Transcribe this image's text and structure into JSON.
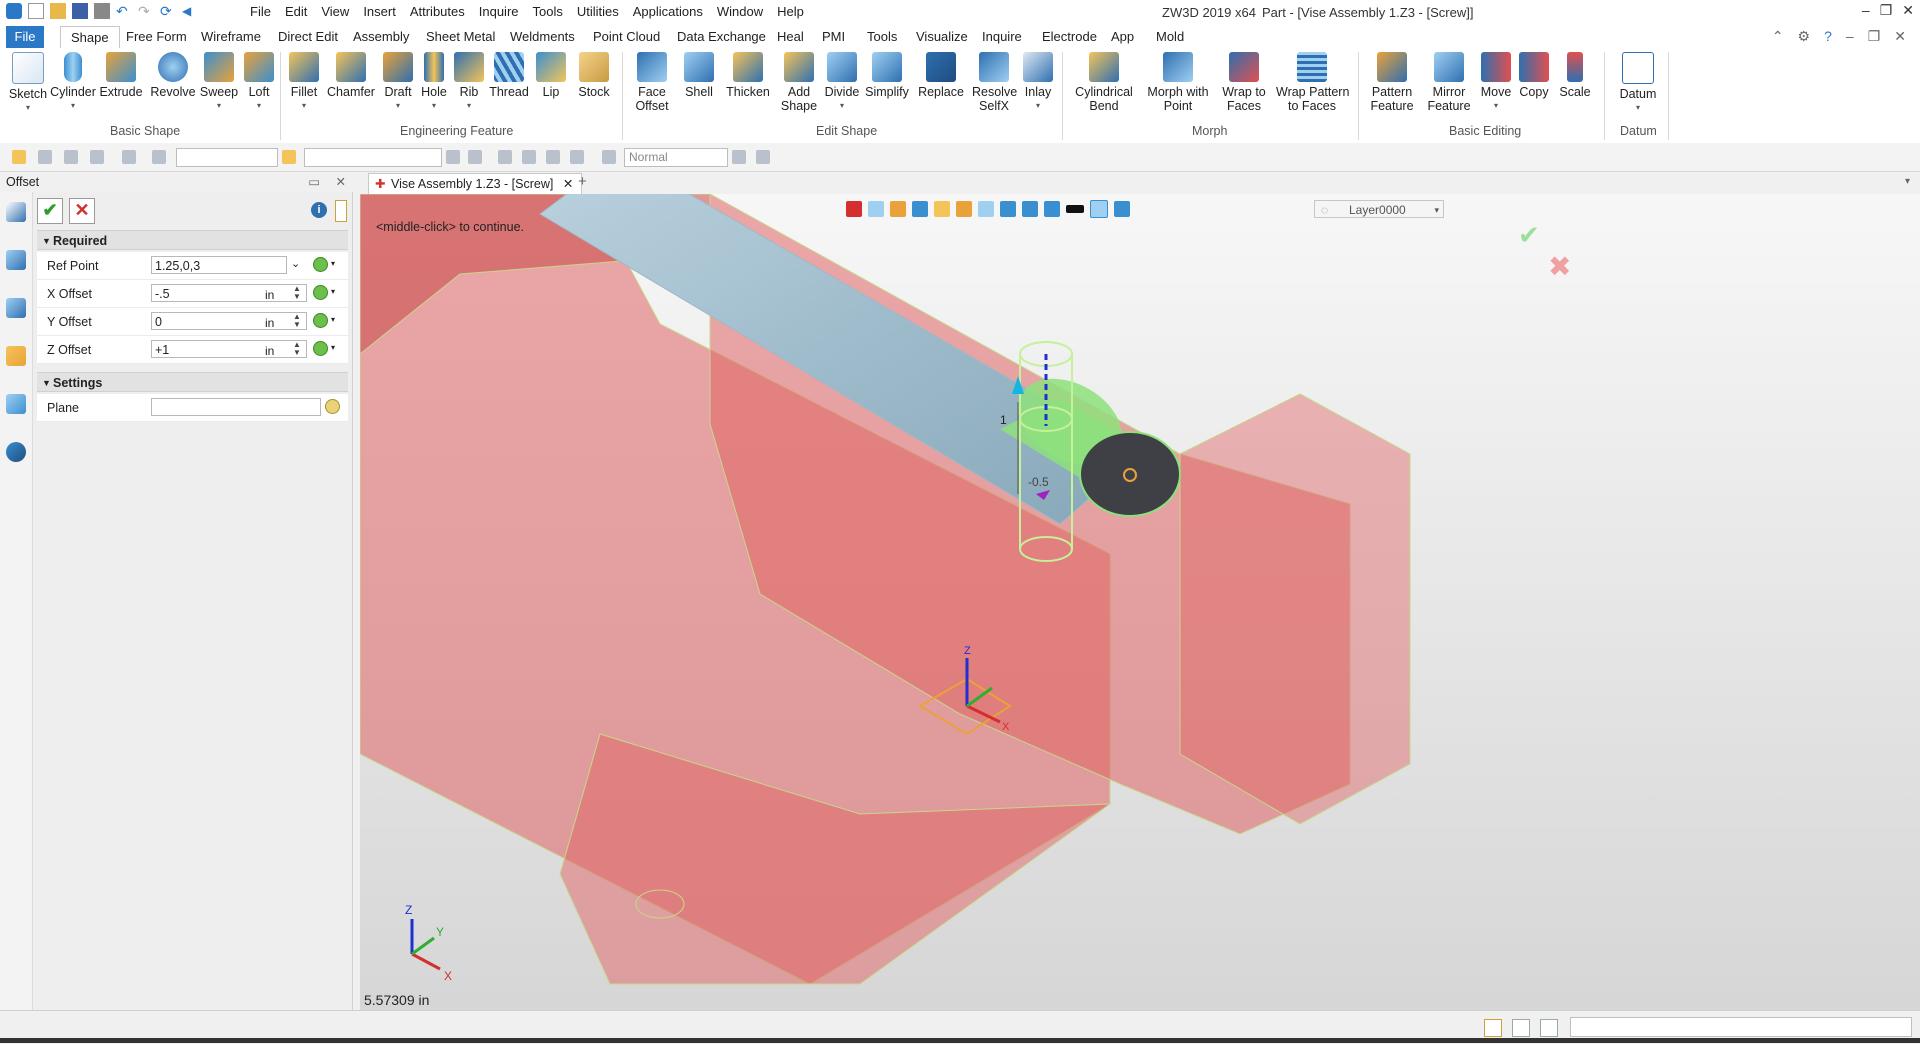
{
  "titlebar": {
    "menu": [
      "File",
      "Edit",
      "View",
      "Insert",
      "Attributes",
      "Inquire",
      "Tools",
      "Utilities",
      "Applications",
      "Window",
      "Help"
    ],
    "app_title": "ZW3D 2019  x64",
    "doc_title": "Part - [Vise Assembly 1.Z3 - [Screw]]"
  },
  "ribbon_tabs": [
    "File",
    "Shape",
    "Free Form",
    "Wireframe",
    "Direct Edit",
    "Assembly",
    "Sheet Metal",
    "Weldments",
    "Point Cloud",
    "Data Exchange",
    "Heal",
    "PMI",
    "Tools",
    "Visualize",
    "Inquire",
    "Electrode",
    "App",
    "Mold"
  ],
  "active_tab": "Shape",
  "ribbon": {
    "basic_shape": {
      "label": "Basic Shape",
      "buttons": [
        "Sketch",
        "Cylinder",
        "Extrude",
        "Revolve",
        "Sweep",
        "Loft"
      ]
    },
    "engineering_feature": {
      "label": "Engineering Feature",
      "buttons": [
        "Fillet",
        "Chamfer",
        "Draft",
        "Hole",
        "Rib",
        "Thread",
        "Lip",
        "Stock"
      ]
    },
    "edit_shape": {
      "label": "Edit Shape",
      "buttons": [
        [
          "Face",
          "Offset"
        ],
        [
          "Shell"
        ],
        [
          "Thicken"
        ],
        [
          "Add",
          "Shape"
        ],
        [
          "Divide"
        ],
        [
          "Simplify"
        ],
        [
          "Replace"
        ],
        [
          "Resolve",
          "SelfX"
        ],
        [
          "Inlay"
        ]
      ]
    },
    "morph": {
      "label": "Morph",
      "buttons": [
        [
          "Cylindrical",
          "Bend"
        ],
        [
          "Morph with",
          "Point"
        ],
        [
          "Wrap to",
          "Faces"
        ],
        [
          "Wrap Pattern",
          "to Faces"
        ]
      ]
    },
    "basic_editing": {
      "label": "Basic Editing",
      "buttons": [
        [
          "Pattern",
          "Feature"
        ],
        [
          "Mirror",
          "Feature"
        ],
        [
          "Move"
        ],
        [
          "Copy"
        ],
        [
          "Scale"
        ]
      ]
    },
    "datum": {
      "label": "Datum",
      "buttons": [
        "Datum"
      ]
    }
  },
  "toolbar2": {
    "render_mode": "Normal"
  },
  "panel": {
    "title": "Offset",
    "required_label": "Required",
    "fields": [
      {
        "label": "Ref Point",
        "value": "1.25,0,3",
        "unit": ""
      },
      {
        "label": "X Offset",
        "value": "-.5",
        "unit": "in"
      },
      {
        "label": "Y Offset",
        "value": "0",
        "unit": "in"
      },
      {
        "label": "Z Offset",
        "value": "+1",
        "unit": "in"
      }
    ],
    "settings_label": "Settings",
    "plane_label": "Plane",
    "plane_value": ""
  },
  "viewport": {
    "tab_label": "Vise Assembly 1.Z3 - [Screw]",
    "hint": "<middle-click> to continue.",
    "layer": "Layer0000",
    "measure": "5.57309 in",
    "dim_label_1": "1",
    "dim_label_2": "-0.5",
    "axis_z": "Z",
    "axis_y": "Y",
    "axis_x": "X"
  },
  "colors": {
    "accent": "#2b78c6",
    "part_red": "#e06464",
    "screw_blue": "#a9c3d3",
    "highlight_green": "#8ee07c"
  }
}
